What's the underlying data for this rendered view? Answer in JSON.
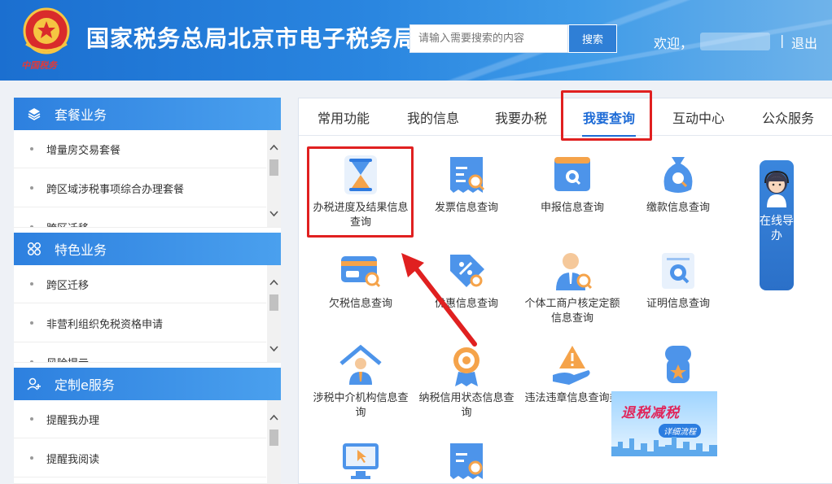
{
  "header": {
    "site_title": "国家税务总局北京市电子税务局",
    "logo_text": "中国税务",
    "search_placeholder": "请输入需要搜索的内容",
    "search_button": "搜索",
    "welcome": "欢迎，",
    "separator": "|",
    "logout": "退出"
  },
  "sidebar": {
    "sections": [
      {
        "title": "套餐业务",
        "icon": "layers-icon",
        "items": [
          "增量房交易套餐",
          "跨区域涉税事项综合办理套餐",
          "跨区迁移"
        ]
      },
      {
        "title": "特色业务",
        "icon": "grid-icon",
        "items": [
          "跨区迁移",
          "非营利组织免税资格申请",
          "风险提示"
        ]
      },
      {
        "title": "定制e服务",
        "icon": "user-add-icon",
        "items": [
          "提醒我办理",
          "提醒我阅读"
        ]
      }
    ]
  },
  "tabs": [
    {
      "label": "常用功能"
    },
    {
      "label": "我的信息"
    },
    {
      "label": "我要办税"
    },
    {
      "label": "我要查询",
      "active": true
    },
    {
      "label": "互动中心"
    },
    {
      "label": "公众服务"
    }
  ],
  "services": [
    {
      "label": "办税进度及结果信息查询",
      "icon": "hourglass-icon"
    },
    {
      "label": "发票信息查询",
      "icon": "invoice-search-icon"
    },
    {
      "label": "申报信息查询",
      "icon": "monitor-search-icon"
    },
    {
      "label": "缴款信息查询",
      "icon": "money-bag-search-icon"
    },
    {
      "label": "欠税信息查询",
      "icon": "card-search-icon"
    },
    {
      "label": "优惠信息查询",
      "icon": "discount-tag-icon"
    },
    {
      "label": "个体工商户核定定额信息查询",
      "icon": "person-search-icon"
    },
    {
      "label": "证明信息查询",
      "icon": "certificate-search-icon"
    },
    {
      "label": "涉税中介机构信息查询",
      "icon": "house-person-icon"
    },
    {
      "label": "纳税信用状态信息查询",
      "icon": "medal-icon"
    },
    {
      "label": "违法违章信息查询类",
      "icon": "warning-hand-icon"
    },
    {
      "label": "",
      "icon": "star-badge-icon"
    },
    {
      "label": "",
      "icon": "screen-cursor-icon"
    },
    {
      "label": "",
      "icon": "invoice-search-icon"
    }
  ],
  "guide": {
    "text": "在线导办",
    "icon": "service-agent-icon"
  },
  "banner": {
    "title": "退税减税",
    "subtitle": "详细流程"
  },
  "colors": {
    "brand_blue": "#2a86e0",
    "accent_red": "#e02020",
    "tab_active": "#1d6bd6"
  }
}
